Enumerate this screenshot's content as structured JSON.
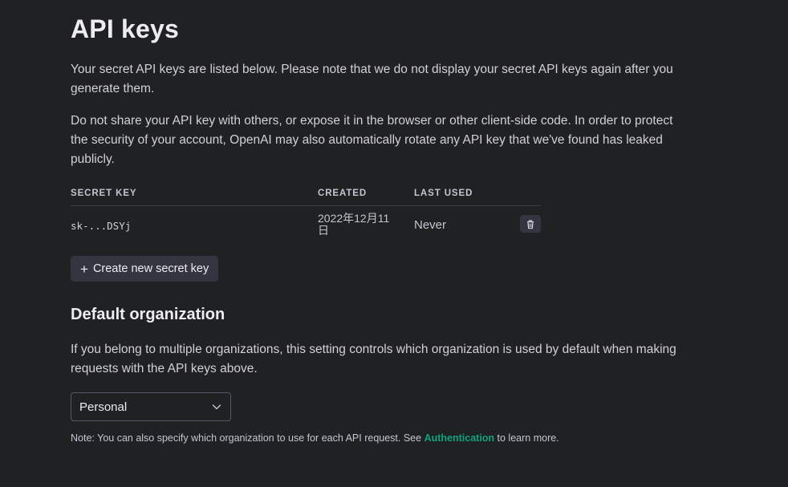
{
  "page": {
    "title": "API keys",
    "intro": "Your secret API keys are listed below. Please note that we do not display your secret API keys again after you generate them.",
    "warning": "Do not share your API key with others, or expose it in the browser or other client-side code. In order to protect the security of your account, OpenAI may also automatically rotate any API key that we've found has leaked publicly."
  },
  "keys_table": {
    "headers": {
      "secret_key": "SECRET KEY",
      "created": "CREATED",
      "last_used": "LAST USED"
    },
    "rows": [
      {
        "secret_key": "sk-...DSYj",
        "created": "2022年12月11日",
        "last_used": "Never",
        "delete_icon": "trash-icon"
      }
    ]
  },
  "create_button": {
    "icon": "plus-icon",
    "label": "Create new secret key"
  },
  "default_org": {
    "heading": "Default organization",
    "description": "If you belong to multiple organizations, this setting controls which organization is used by default when making requests with the API keys above.",
    "select_value": "Personal",
    "select_icon": "chevron-down-icon"
  },
  "note": {
    "prefix": "Note: You can also specify which organization to use for each API request. See ",
    "link": "Authentication",
    "suffix": " to learn more."
  },
  "colors": {
    "background": "#202123",
    "surface": "#343541",
    "text": "#d1d1d6",
    "heading": "#ececf1",
    "link": "#10a37f",
    "border": "#565869"
  }
}
